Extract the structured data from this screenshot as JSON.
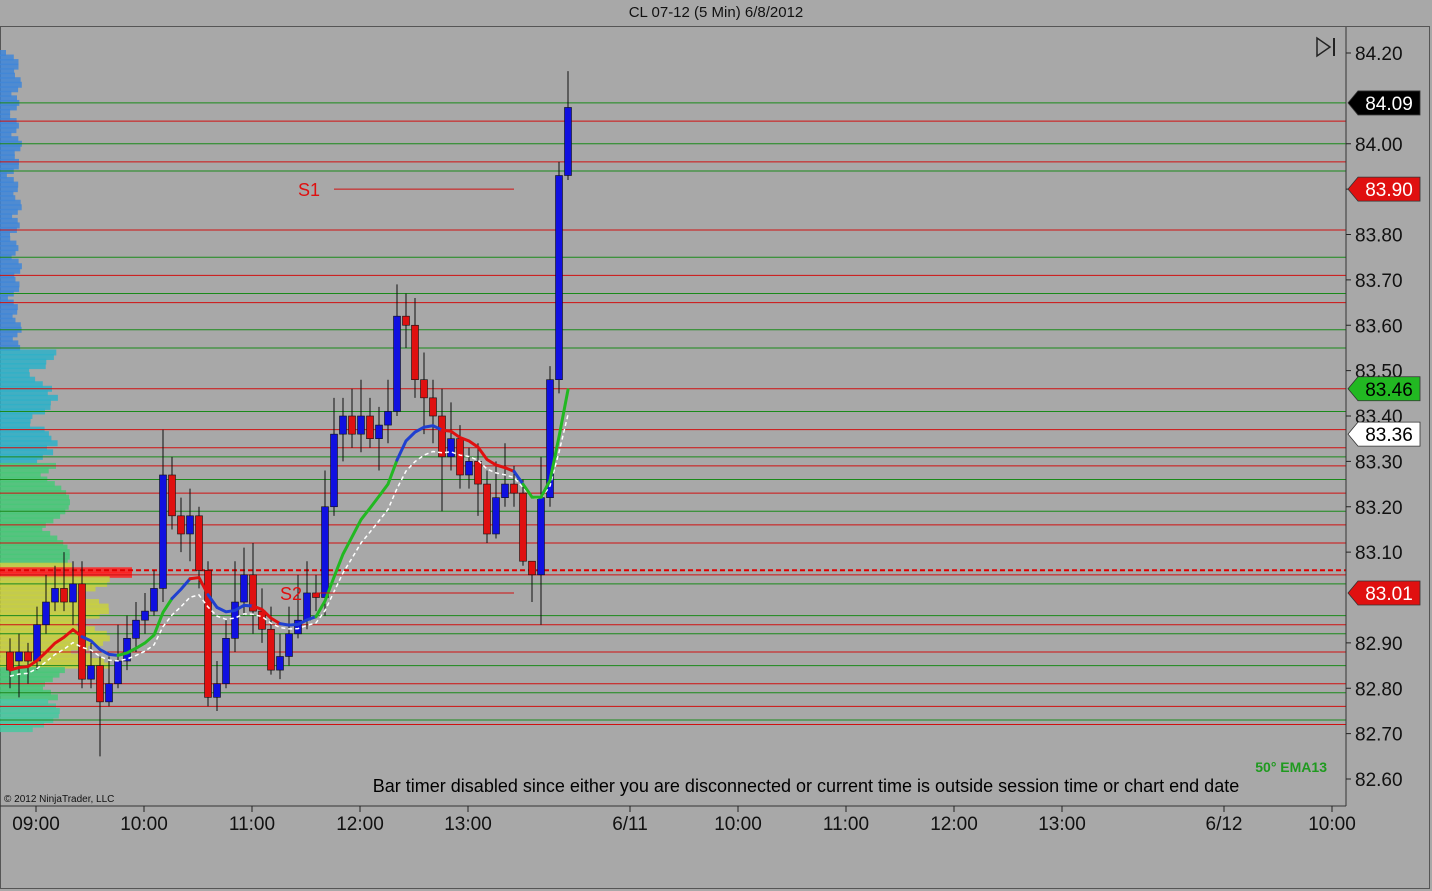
{
  "window": {
    "title": "CL 07-12 (5 Min)  6/8/2012"
  },
  "copyright": "© 2012 NinjaTrader, LLC",
  "status_message": "Bar timer disabled since either you are disconnected or current time is outside session time or chart end date",
  "indicator_label": "50° EMA13",
  "colors": {
    "up_bar": "#1010e0",
    "down_bar": "#e01010",
    "ema_up": "#22b822",
    "ema_down": "#e01010",
    "ema_flat": "#2040d0",
    "background": "#a8a8a8"
  },
  "chart_data": {
    "type": "candlestick",
    "title": "CL 07-12 (5 Min)  6/8/2012",
    "ylim": [
      82.56,
      84.26
    ],
    "ytick_labels": [
      "84.20",
      "84.00",
      "83.90",
      "83.80",
      "83.70",
      "83.60",
      "83.50",
      "83.40",
      "83.30",
      "83.20",
      "83.10",
      "82.90",
      "82.80",
      "82.70",
      "82.60"
    ],
    "ytick_values": [
      84.2,
      84.0,
      83.9,
      83.8,
      83.7,
      83.6,
      83.5,
      83.4,
      83.3,
      83.2,
      83.1,
      82.9,
      82.8,
      82.7,
      82.6
    ],
    "xtick_labels": [
      {
        "label": "09:00",
        "slot": 0
      },
      {
        "label": "10:00",
        "slot": 12
      },
      {
        "label": "11:00",
        "slot": 24
      },
      {
        "label": "12:00",
        "slot": 36
      },
      {
        "label": "13:00",
        "slot": 48
      },
      {
        "label": "6/11",
        "slot": 66
      },
      {
        "label": "10:00",
        "slot": 78
      },
      {
        "label": "11:00",
        "slot": 90
      },
      {
        "label": "12:00",
        "slot": 102
      },
      {
        "label": "13:00",
        "slot": 114
      },
      {
        "label": "6/12",
        "slot": 132
      },
      {
        "label": "10:00",
        "slot": 144
      }
    ],
    "price_markers": [
      {
        "label": "84.09",
        "value": 84.09,
        "bg": "#000000",
        "fg": "#ffffff"
      },
      {
        "label": "83.90",
        "value": 83.9,
        "bg": "#e01010",
        "fg": "#ffffff"
      },
      {
        "label": "83.46",
        "value": 83.46,
        "bg": "#22b822",
        "fg": "#000000"
      },
      {
        "label": "83.36",
        "value": 83.36,
        "bg": "#ffffff",
        "fg": "#000000"
      },
      {
        "label": "83.01",
        "value": 83.01,
        "bg": "#e01010",
        "fg": "#ffffff"
      }
    ],
    "pivot_labels": [
      {
        "label": "S1",
        "value": 83.9,
        "x_from_slot": 36,
        "x_to_slot": 56
      },
      {
        "label": "S2",
        "value": 83.01,
        "x_from_slot": 34,
        "x_to_slot": 56
      }
    ],
    "hlines_red": [
      84.05,
      83.96,
      83.81,
      83.71,
      83.65,
      83.46,
      83.37,
      83.33,
      83.29,
      83.23,
      83.16,
      83.12,
      83.05,
      82.94,
      82.88,
      82.81,
      82.76,
      82.72
    ],
    "hlines_green": [
      84.09,
      84.0,
      83.94,
      83.75,
      83.67,
      83.59,
      83.55,
      83.41,
      83.31,
      83.26,
      83.19,
      83.03,
      82.96,
      82.92,
      82.85,
      82.79,
      82.73
    ],
    "dashed_line": 83.06,
    "candles": [
      [
        82.88,
        82.84,
        82.8,
        82.91
      ],
      [
        82.86,
        82.88,
        82.78,
        82.92
      ],
      [
        82.88,
        82.86,
        82.81,
        82.9
      ],
      [
        82.86,
        82.94,
        82.84,
        82.98
      ],
      [
        82.94,
        82.99,
        82.92,
        83.05
      ],
      [
        82.99,
        83.02,
        82.97,
        83.07
      ],
      [
        83.02,
        82.99,
        82.97,
        83.1
      ],
      [
        82.99,
        83.03,
        82.94,
        83.08
      ],
      [
        83.03,
        82.82,
        82.8,
        83.08
      ],
      [
        82.82,
        82.85,
        82.8,
        82.9
      ],
      [
        82.85,
        82.77,
        82.65,
        82.87
      ],
      [
        82.77,
        82.81,
        82.76,
        82.87
      ],
      [
        82.81,
        82.86,
        82.8,
        82.94
      ],
      [
        82.86,
        82.91,
        82.84,
        82.96
      ],
      [
        82.91,
        82.95,
        82.88,
        82.99
      ],
      [
        82.95,
        82.97,
        82.92,
        83.01
      ],
      [
        82.97,
        83.02,
        82.96,
        83.06
      ],
      [
        83.02,
        83.27,
        82.99,
        83.37
      ],
      [
        83.27,
        83.18,
        83.15,
        83.31
      ],
      [
        83.18,
        83.14,
        83.1,
        83.22
      ],
      [
        83.14,
        83.18,
        83.08,
        83.24
      ],
      [
        83.18,
        83.06,
        83.02,
        83.2
      ],
      [
        83.06,
        82.78,
        82.76,
        83.08
      ],
      [
        82.78,
        82.81,
        82.75,
        82.86
      ],
      [
        82.81,
        82.91,
        82.8,
        82.95
      ],
      [
        82.91,
        82.99,
        82.88,
        83.08
      ],
      [
        82.99,
        83.05,
        82.96,
        83.11
      ],
      [
        83.05,
        82.97,
        82.92,
        83.12
      ],
      [
        82.97,
        82.93,
        82.9,
        83.02
      ],
      [
        82.93,
        82.84,
        82.83,
        82.98
      ],
      [
        82.84,
        82.87,
        82.82,
        82.92
      ],
      [
        82.87,
        82.92,
        82.85,
        82.98
      ],
      [
        82.92,
        82.95,
        82.91,
        83.05
      ],
      [
        82.95,
        83.01,
        82.93,
        83.08
      ],
      [
        83.01,
        83.0,
        82.97,
        83.05
      ],
      [
        83.0,
        83.2,
        82.96,
        83.28
      ],
      [
        83.2,
        83.36,
        83.18,
        83.44
      ],
      [
        83.36,
        83.4,
        83.3,
        83.44
      ],
      [
        83.4,
        83.36,
        83.33,
        83.46
      ],
      [
        83.36,
        83.4,
        83.32,
        83.48
      ],
      [
        83.4,
        83.35,
        83.33,
        83.44
      ],
      [
        83.35,
        83.38,
        83.28,
        83.42
      ],
      [
        83.38,
        83.41,
        83.34,
        83.48
      ],
      [
        83.41,
        83.62,
        83.4,
        83.69
      ],
      [
        83.62,
        83.6,
        83.55,
        83.67
      ],
      [
        83.6,
        83.48,
        83.44,
        83.66
      ],
      [
        83.48,
        83.44,
        83.36,
        83.54
      ],
      [
        83.44,
        83.4,
        83.34,
        83.48
      ],
      [
        83.4,
        83.31,
        83.19,
        83.46
      ],
      [
        83.31,
        83.35,
        83.28,
        83.43
      ],
      [
        83.35,
        83.27,
        83.24,
        83.38
      ],
      [
        83.27,
        83.3,
        83.24,
        83.33
      ],
      [
        83.3,
        83.25,
        83.18,
        83.34
      ],
      [
        83.25,
        83.14,
        83.12,
        83.28
      ],
      [
        83.14,
        83.22,
        83.13,
        83.3
      ],
      [
        83.22,
        83.25,
        83.2,
        83.34
      ],
      [
        83.25,
        83.23,
        83.2,
        83.29
      ],
      [
        83.23,
        83.08,
        83.07,
        83.26
      ],
      [
        83.08,
        83.05,
        82.99,
        83.08
      ],
      [
        83.05,
        83.22,
        82.94,
        83.31
      ],
      [
        83.22,
        83.48,
        83.2,
        83.51
      ],
      [
        83.48,
        83.93,
        83.45,
        83.96
      ],
      [
        83.93,
        84.08,
        83.92,
        84.16
      ]
    ],
    "ema_trend": [
      {
        "from": 0,
        "to": 8,
        "color": "down"
      },
      {
        "from": 8,
        "to": 12,
        "color": "flat"
      },
      {
        "from": 12,
        "to": 18,
        "color": "up"
      },
      {
        "from": 18,
        "to": 20,
        "color": "flat"
      },
      {
        "from": 20,
        "to": 22,
        "color": "down"
      },
      {
        "from": 22,
        "to": 27,
        "color": "flat"
      },
      {
        "from": 27,
        "to": 30,
        "color": "down"
      },
      {
        "from": 30,
        "to": 34,
        "color": "flat"
      },
      {
        "from": 34,
        "to": 43,
        "color": "up"
      },
      {
        "from": 43,
        "to": 48,
        "color": "flat"
      },
      {
        "from": 48,
        "to": 56,
        "color": "down"
      },
      {
        "from": 56,
        "to": 57,
        "color": "flat"
      },
      {
        "from": 57,
        "to": 62,
        "color": "up"
      }
    ]
  }
}
